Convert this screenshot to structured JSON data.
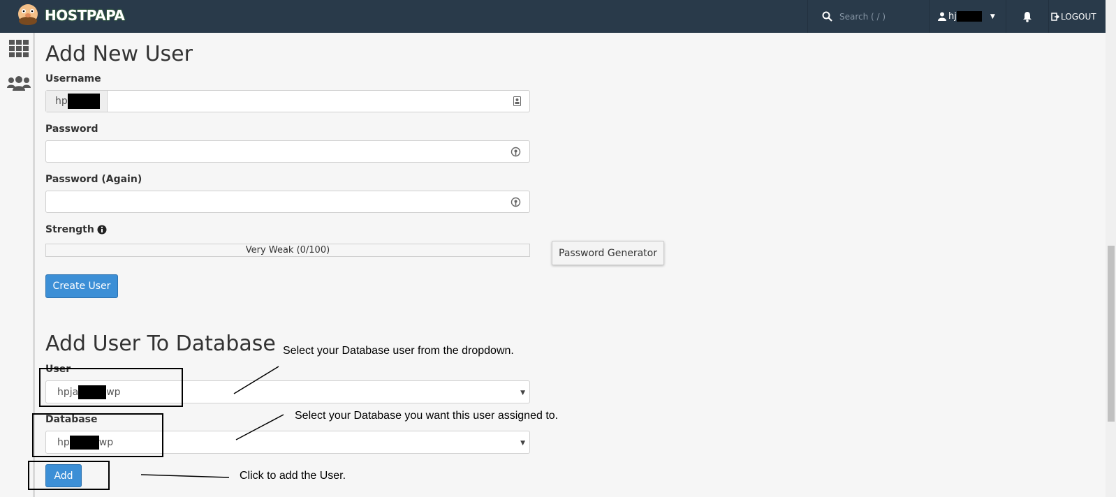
{
  "header": {
    "logo_text": "HOSTPAPA",
    "search_placeholder": "Search ( / )",
    "user_label": "hj",
    "logout_label": "LOGOUT"
  },
  "sidebar": {
    "icons": [
      "grid-icon",
      "users-icon"
    ]
  },
  "add_new_user": {
    "title": "Add New User",
    "username_label": "Username",
    "username_prefix": "hp",
    "username_value": "",
    "password_label": "Password",
    "password_value": "",
    "password_again_label": "Password (Again)",
    "password_again_value": "",
    "strength_label": "Strength",
    "strength_text": "Very Weak (0/100)",
    "strength_value": 0,
    "password_generator_label": "Password Generator",
    "create_user_label": "Create User"
  },
  "add_user_to_db": {
    "title": "Add User To Database",
    "user_label": "User",
    "user_value_prefix": "hpja",
    "user_value_suffix": "wp",
    "database_label": "Database",
    "database_value_prefix": "hp",
    "database_value_suffix": "wp",
    "add_label": "Add"
  },
  "annotations": {
    "user_note": "Select your Database user from the dropdown.",
    "database_note": "Select your Database you want this user assigned to.",
    "add_note": "Click to add the User."
  },
  "colors": {
    "topbar": "#293a4a",
    "primary": "#3c8fd6",
    "background": "#f6f6f6"
  }
}
